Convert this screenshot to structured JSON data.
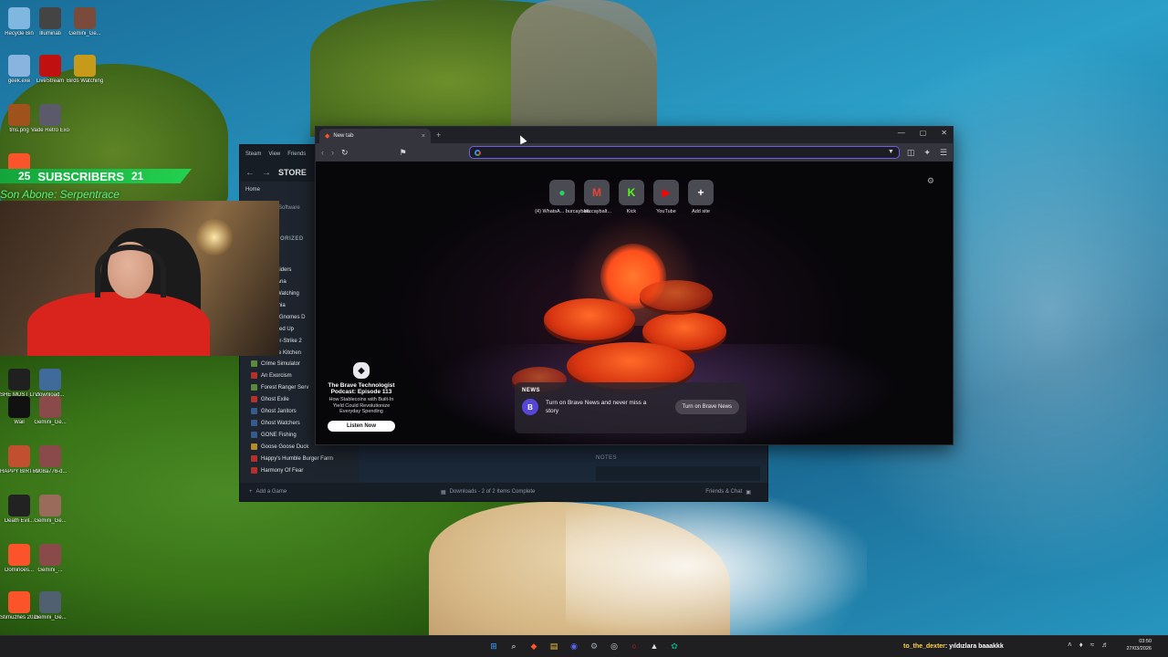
{
  "desktop_icons": [
    {
      "label": "Recycle Bin",
      "icon": "recycle-bin-icon",
      "color": "#7fb7e0"
    },
    {
      "label": "Illuminati",
      "icon": "triangle-eye-icon",
      "color": "#444"
    },
    {
      "label": "Gemini_Ge...",
      "icon": "image-thumb-icon",
      "color": "#7a4a3a"
    },
    {
      "label": "geek.exe",
      "icon": "trash-can-icon",
      "color": "#8ab4e0"
    },
    {
      "label": "LiveStream",
      "icon": "live-stream-icon",
      "color": "#c01010"
    },
    {
      "label": "Birds Watching",
      "icon": "birds-watching-icon",
      "color": "#c89a1a"
    },
    {
      "label": "tms.png",
      "icon": "image-thumb-icon",
      "color": "#a0521c"
    },
    {
      "label": "Vade Retro Exorcist",
      "icon": "game-icon",
      "color": "#5a5a6a"
    },
    {
      "label": "Karabudak...",
      "icon": "brave-icon",
      "color": "#fb542b"
    },
    {
      "label": "SHE MUST LIVE",
      "icon": "game-icon",
      "color": "#202020"
    },
    {
      "label": "download...",
      "icon": "image-thumb-icon",
      "color": "#406a9a"
    },
    {
      "label": "Wail",
      "icon": "wail-w-icon",
      "color": "#111"
    },
    {
      "label": "Gemini_Ge...",
      "icon": "image-thumb-icon",
      "color": "#8a4a4a"
    },
    {
      "label": "HAPPY BIRTHDAY",
      "icon": "image-thumb-icon",
      "color": "#c05030"
    },
    {
      "label": "7908a776-d...",
      "icon": "image-thumb-icon",
      "color": "#8a4a4a"
    },
    {
      "label": "Death Evil...",
      "icon": "game-icon",
      "color": "#222"
    },
    {
      "label": "Gemini_Ge...",
      "icon": "image-thumb-icon",
      "color": "#9a6a5a"
    },
    {
      "label": "Dominoes...",
      "icon": "brave-icon",
      "color": "#fb542b"
    },
    {
      "label": "Gemini_...",
      "icon": "image-thumb-icon",
      "color": "#8a4a4a"
    },
    {
      "label": "Stimuzhes 2026 Mart B...",
      "icon": "brave-icon",
      "color": "#fb542b"
    },
    {
      "label": "Gemini_Ge...",
      "icon": "image-thumb-icon",
      "color": "#506070"
    }
  ],
  "overlay": {
    "subscribers_label": "SUBSCRIBERS",
    "subscribers_left": "25",
    "subscribers_right": "21",
    "abone_text": "Son Abone: Serpentrace"
  },
  "steam": {
    "menu": [
      "Steam",
      "View",
      "Friends"
    ],
    "store_label": "STORE",
    "home_label": "Home",
    "software_label": "Software",
    "category_label": "ORIZED",
    "partial_items": [
      "aiders",
      "Ana",
      "Watching",
      "mia",
      "' Gnomes D",
      "ked Up",
      "er-Strike 2",
      "re Kitchen"
    ],
    "games": [
      {
        "name": "Crime Simulator",
        "color": "g"
      },
      {
        "name": "An Exorcism",
        "color": "r"
      },
      {
        "name": "Forest Ranger Serv",
        "color": "g"
      },
      {
        "name": "Ghost Exile",
        "color": "r"
      },
      {
        "name": "Ghost Janitors",
        "color": "b"
      },
      {
        "name": "Ghost Watchers",
        "color": "b"
      },
      {
        "name": "GONE Fishing",
        "color": "b"
      },
      {
        "name": "Goose Goose Duck",
        "color": "y"
      },
      {
        "name": "Happy's Humble Burger Farm",
        "color": "r"
      },
      {
        "name": "Harmony Of Fear",
        "color": "r"
      }
    ],
    "notes_label": "NOTES",
    "footer_add": "Add a Game",
    "footer_downloads": "Downloads - 2 of 2 Items Complete",
    "footer_friends": "Friends & Chat"
  },
  "brave": {
    "tab_title": "New tab",
    "url_value": "",
    "tiles": [
      {
        "label": "(4) WhatsA... burcaybalt...",
        "glyph": "●",
        "color": "#25d366",
        "icon": "whatsapp-icon"
      },
      {
        "label": "burcaybalt...",
        "glyph": "M",
        "color": "#ea4335",
        "icon": "gmail-icon"
      },
      {
        "label": "Kick",
        "glyph": "K",
        "color": "#53fc18",
        "icon": "kick-icon"
      },
      {
        "label": "YouTube",
        "glyph": "▶",
        "color": "#ff0000",
        "icon": "youtube-icon"
      },
      {
        "label": "Add site",
        "glyph": "+",
        "color": "#ffffff",
        "icon": "add-site-icon"
      }
    ],
    "podcast": {
      "title": "The Brave Technologist Podcast: Episode 113",
      "desc": "How Stablecoins with Built-In Yield Could Revolutionize Everyday Spending",
      "button": "Listen Now"
    },
    "news": {
      "header": "NEWS",
      "message": "Turn on Brave News and never miss a story",
      "button": "Turn on Brave News"
    }
  },
  "taskbar": {
    "icons": [
      "windows-start-icon",
      "search-icon",
      "brave-icon",
      "file-explorer-icon",
      "discord-icon",
      "steam-icon",
      "obs-icon",
      "opera-icon",
      "epic-icon",
      "chatgpt-icon"
    ],
    "chat_user": "to_the_dexter",
    "chat_text": ": yıldızlara baaakkk",
    "time": "03:50",
    "date": "27/03/2026"
  }
}
